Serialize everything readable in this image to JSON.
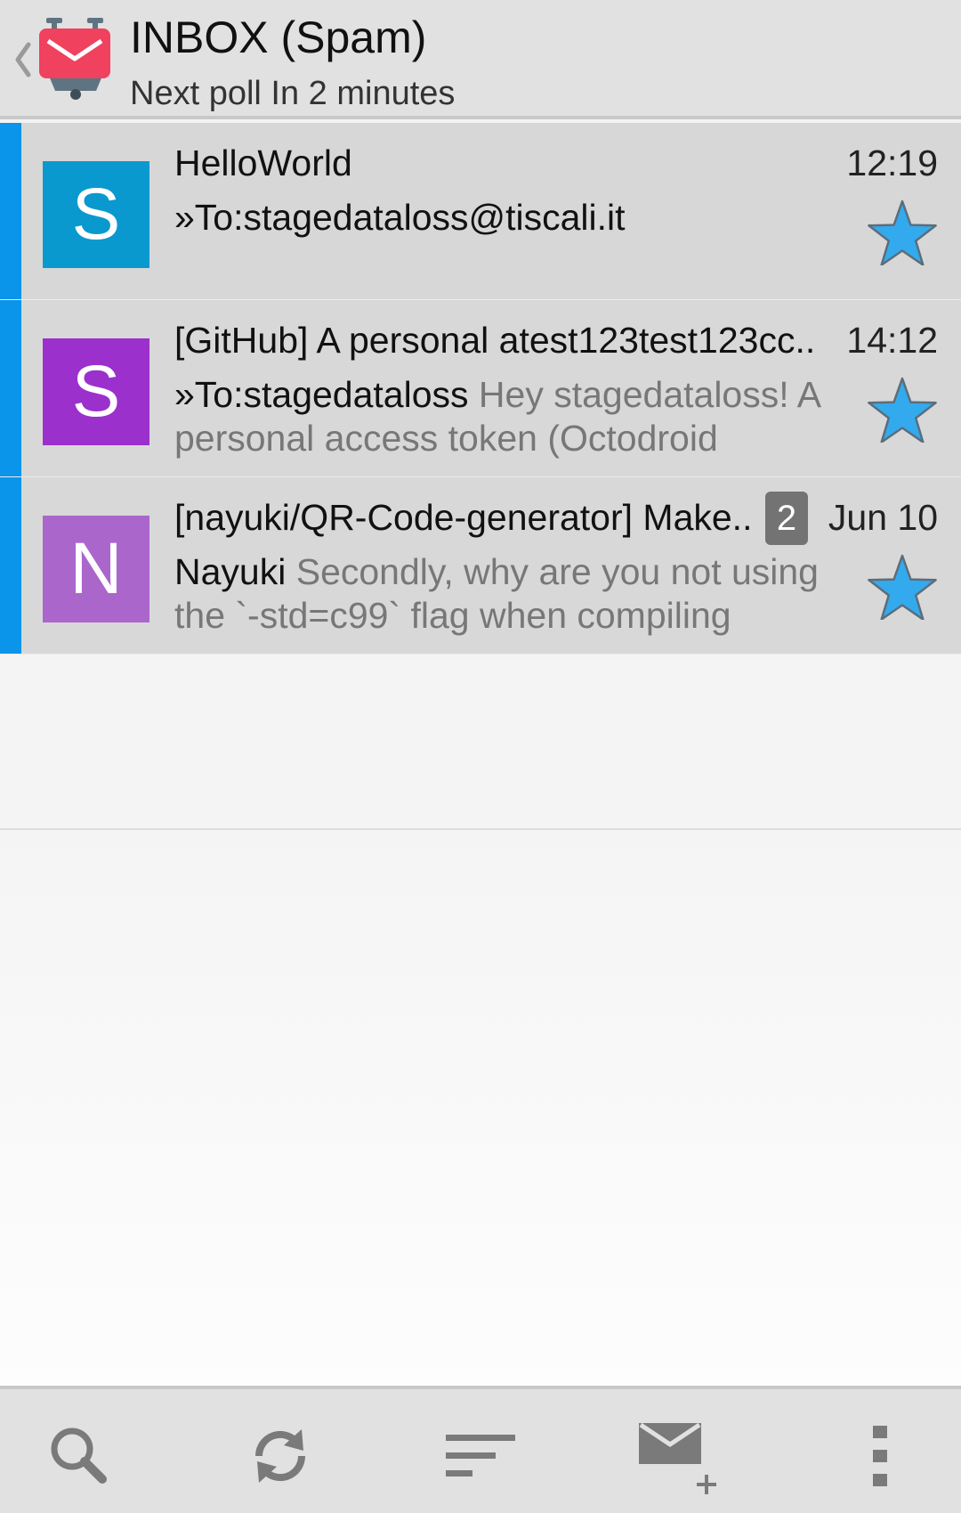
{
  "action_bar": {
    "title": "INBOX (Spam)",
    "subtitle": "Next poll In 2 minutes",
    "up_icon": "chevron-left-icon",
    "app_icon": "k9-mail-robot-icon"
  },
  "messages": [
    {
      "avatar_letter": "S",
      "avatar_color": "#0a99cf",
      "subject": "HelloWorld",
      "date": "12:19",
      "sender": "»To:stagedataloss@tiscali.it",
      "preview": "",
      "thread_count": "",
      "starred": true,
      "unread": true
    },
    {
      "avatar_letter": "S",
      "avatar_color": "#9b30cc",
      "subject": "[GitHub] A personal atest123test123cc..",
      "date": "14:12",
      "sender": "»To:stagedataloss",
      "preview": "Hey stagedataloss! A personal access token (Octodroid",
      "thread_count": "",
      "starred": true,
      "unread": true
    },
    {
      "avatar_letter": "N",
      "avatar_color": "#ab66cc",
      "subject": "[nayuki/QR-Code-generator] Make..",
      "date": "Jun 10",
      "sender": "Nayuki",
      "preview": "Secondly, why are you not using the `-std=c99` flag when compiling",
      "thread_count": "2",
      "starred": true,
      "unread": true
    }
  ],
  "colors": {
    "accent": "#0a94ea",
    "star": "#33aaee",
    "bar_bg": "#e1e1e1",
    "row_bg": "#d8d8d8"
  },
  "bottom_bar": {
    "icons": [
      "search-icon",
      "refresh-icon",
      "sort-icon",
      "compose-icon",
      "overflow-menu-icon"
    ]
  }
}
